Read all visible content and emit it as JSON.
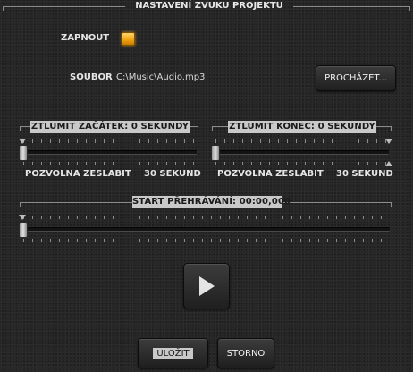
{
  "dialog": {
    "title": "NASTAVENÍ ZVUKU PROJEKTU"
  },
  "enable": {
    "label": "ZAPNOUT",
    "checked": true
  },
  "file": {
    "label": "SOUBOR",
    "path": "C:\\Music\\Audio.mp3",
    "browse_label": "PROCHÁZET..."
  },
  "fade_in": {
    "title": "ZTLUMIT ZAČÁTEK: 0 SEKUNDY",
    "left_label": "POZVOLNA ZESLABIT",
    "right_label": "30 SEKUND",
    "value_seconds": 0,
    "max_seconds": 30
  },
  "fade_out": {
    "title": "ZTLUMIT KONEC: 0 SEKUNDY",
    "left_label": "POZVOLNA ZESLABIT",
    "right_label": "30 SEKUND",
    "value_seconds": 0,
    "max_seconds": 30
  },
  "start": {
    "title": "START PŘEHRÁVÁNÍ: 00:00,000",
    "value_fraction": 0
  },
  "buttons": {
    "save_label": "ULOŽIT",
    "cancel_label": "STORNO"
  },
  "colors": {
    "accent": "#f0a10e",
    "title_bg": "#c9c9c9",
    "background": "#262626"
  },
  "icons": {
    "play": "play-icon",
    "checkbox": "checkbox-checked-icon"
  }
}
